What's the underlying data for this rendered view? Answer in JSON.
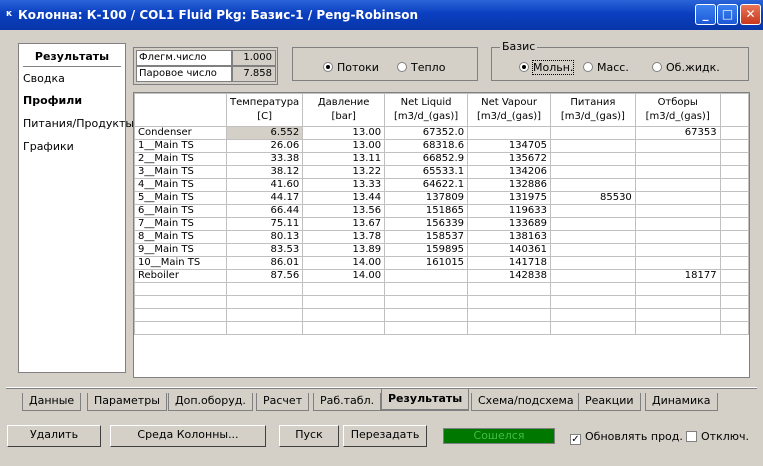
{
  "window": {
    "title": "Колонна: К-100 / COL1  Fluid Pkg: Базис-1 / Peng-Robinson",
    "minimize": "_",
    "maximize": "□",
    "close": "✕"
  },
  "leftnav": {
    "title": "Результаты",
    "items": [
      "Сводка",
      "Профили",
      "Питания/Продукты",
      "Графики"
    ],
    "active": "Профили"
  },
  "params": {
    "reflux_label": "Флегм.число",
    "reflux_value": "1.000",
    "boilup_label": "Паровое число",
    "boilup_value": "7.858"
  },
  "flow_heat": {
    "flows": "Потоки",
    "heat": "Тепло",
    "selected": "Потоки"
  },
  "basis": {
    "legend": "Базис",
    "molar": "Мольн.",
    "mass": "Масс.",
    "vol": "Об.жидк.",
    "selected": "Мольн."
  },
  "table": {
    "columns": [
      "",
      "Температура\n[C]",
      "Давление\n[bar]",
      "Net Liquid\n[m3/d_(gas)]",
      "Net Vapour\n[m3/d_(gas)]",
      "Питания\n[m3/d_(gas)]",
      "Отборы\n[m3/d_(gas)]"
    ],
    "rows": [
      [
        "Condenser",
        "6.552",
        "13.00",
        "67352.0",
        "",
        "",
        "67353"
      ],
      [
        "1__Main TS",
        "26.06",
        "13.00",
        "68318.6",
        "134705",
        "",
        ""
      ],
      [
        "2__Main TS",
        "33.38",
        "13.11",
        "66852.9",
        "135672",
        "",
        ""
      ],
      [
        "3__Main TS",
        "38.12",
        "13.22",
        "65533.1",
        "134206",
        "",
        ""
      ],
      [
        "4__Main TS",
        "41.60",
        "13.33",
        "64622.1",
        "132886",
        "",
        ""
      ],
      [
        "5__Main TS",
        "44.17",
        "13.44",
        "137809",
        "131975",
        "85530",
        ""
      ],
      [
        "6__Main TS",
        "66.44",
        "13.56",
        "151865",
        "119633",
        "",
        ""
      ],
      [
        "7__Main TS",
        "75.11",
        "13.67",
        "156339",
        "133689",
        "",
        ""
      ],
      [
        "8__Main TS",
        "80.13",
        "13.78",
        "158537",
        "138163",
        "",
        ""
      ],
      [
        "9__Main TS",
        "83.53",
        "13.89",
        "159895",
        "140361",
        "",
        ""
      ],
      [
        "10__Main TS",
        "86.01",
        "14.00",
        "161015",
        "141718",
        "",
        ""
      ],
      [
        "Reboiler",
        "87.56",
        "14.00",
        "",
        "142838",
        "",
        "18177"
      ]
    ]
  },
  "tabs": [
    "Данные",
    "Параметры",
    "Доп.оборуд.",
    "Расчет",
    "Раб.табл.",
    "Результаты",
    "Схема/подсхема",
    "Реакции",
    "Динамика"
  ],
  "active_tab": "Результаты",
  "buttons": {
    "delete": "Удалить",
    "column_env": "Среда Колонны...",
    "run": "Пуск",
    "reset": "Перезадать"
  },
  "status": "Сошелся",
  "checks": {
    "update": "Обновлять прод.",
    "update_checked": true,
    "disable": "Отключ.",
    "disable_checked": false
  }
}
